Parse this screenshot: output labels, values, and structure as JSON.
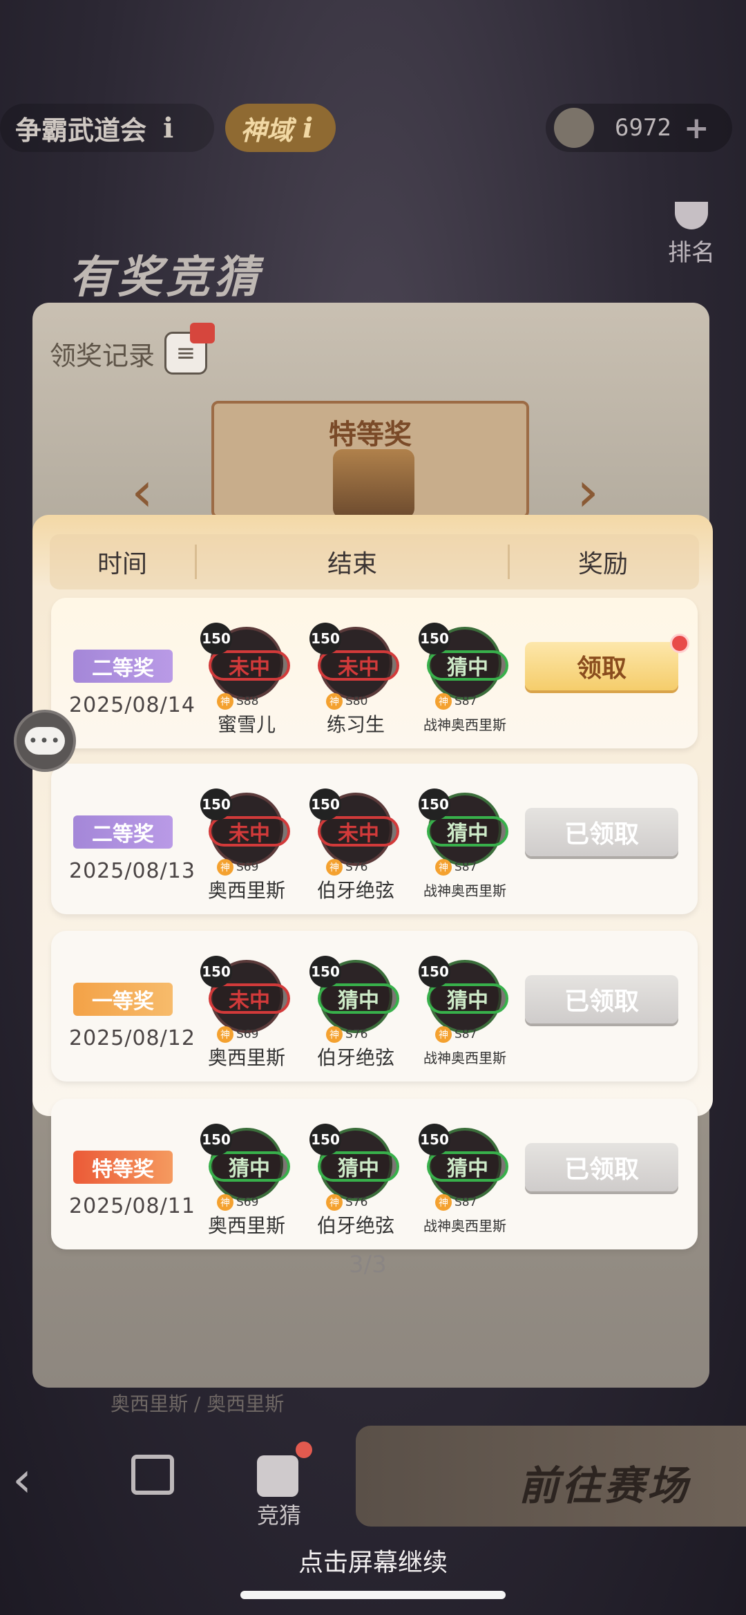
{
  "header": {
    "event_name": "争霸武道会",
    "info_glyph": "i",
    "mode_tag": "神域",
    "currency_value": "6972",
    "currency_plus": "+",
    "rank_label": "排名"
  },
  "background_panel": {
    "title": "有奖竞猜",
    "record_label": "领奖记录",
    "special_prize_title": "特等奖"
  },
  "modal": {
    "columns": [
      "时间",
      "结束",
      "奖励"
    ],
    "rows": [
      {
        "badge": "二等奖",
        "badge_style": "purple",
        "date": "2025/08/14",
        "picks": [
          {
            "level": "150",
            "result": "未中",
            "hit": false,
            "server": "S88",
            "name": "蜜雪儿"
          },
          {
            "level": "150",
            "result": "未中",
            "hit": false,
            "server": "S80",
            "name": "练习生"
          },
          {
            "level": "150",
            "result": "猜中",
            "hit": true,
            "server": "S87",
            "name": "战神奥西里斯"
          }
        ],
        "button": "领取",
        "claimed": false,
        "has_dot": true
      },
      {
        "badge": "二等奖",
        "badge_style": "purple",
        "date": "2025/08/13",
        "picks": [
          {
            "level": "150",
            "result": "未中",
            "hit": false,
            "server": "S69",
            "name": "奥西里斯"
          },
          {
            "level": "150",
            "result": "未中",
            "hit": false,
            "server": "S76",
            "name": "伯牙绝弦"
          },
          {
            "level": "150",
            "result": "猜中",
            "hit": true,
            "server": "S87",
            "name": "战神奥西里斯"
          }
        ],
        "button": "已领取",
        "claimed": true,
        "has_dot": false
      },
      {
        "badge": "一等奖",
        "badge_style": "orange",
        "date": "2025/08/12",
        "picks": [
          {
            "level": "150",
            "result": "未中",
            "hit": false,
            "server": "S69",
            "name": "奥西里斯"
          },
          {
            "level": "150",
            "result": "猜中",
            "hit": true,
            "server": "S76",
            "name": "伯牙绝弦"
          },
          {
            "level": "150",
            "result": "猜中",
            "hit": true,
            "server": "S87",
            "name": "战神奥西里斯"
          }
        ],
        "button": "已领取",
        "claimed": true,
        "has_dot": false
      },
      {
        "badge": "特等奖",
        "badge_style": "red",
        "date": "2025/08/11",
        "picks": [
          {
            "level": "150",
            "result": "猜中",
            "hit": true,
            "server": "S69",
            "name": "奥西里斯"
          },
          {
            "level": "150",
            "result": "猜中",
            "hit": true,
            "server": "S76",
            "name": "伯牙绝弦"
          },
          {
            "level": "150",
            "result": "猜中",
            "hit": true,
            "server": "S87",
            "name": "战神奥西里斯"
          }
        ],
        "button": "已领取",
        "claimed": true,
        "has_dot": false
      }
    ],
    "page_indicator": "3/3",
    "shen_glyph": "神"
  },
  "background_footer": {
    "names_text": "奥西里斯 / 奥西里斯",
    "dice_label": "竞猜",
    "go_button": "前往赛场"
  },
  "overlay": {
    "continue_hint": "点击屏幕继续",
    "chat_glyph": "•••"
  }
}
